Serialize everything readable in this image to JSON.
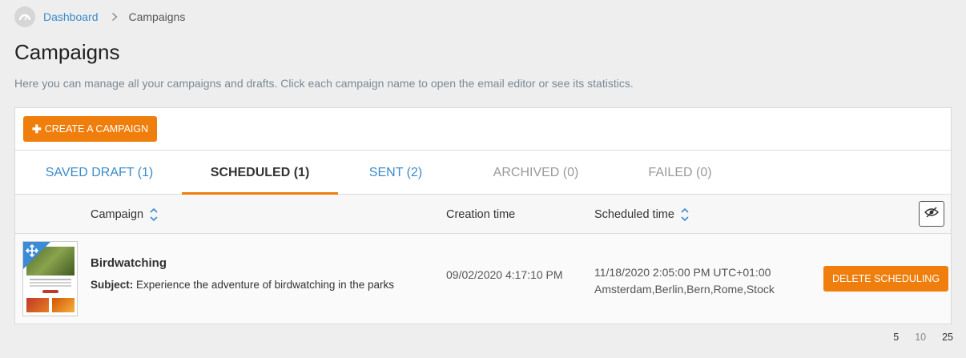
{
  "breadcrumb": {
    "home": "Dashboard",
    "current": "Campaigns"
  },
  "page": {
    "title": "Campaigns",
    "description": "Here you can manage all your campaigns and drafts. Click each campaign name to open the email editor or see its statistics."
  },
  "toolbar": {
    "create_label": "CREATE A CAMPAIGN"
  },
  "tabs": [
    {
      "label": "SAVED DRAFT (1)"
    },
    {
      "label": "SCHEDULED (1)"
    },
    {
      "label": "SENT (2)"
    },
    {
      "label": "ARCHIVED (0)"
    },
    {
      "label": "FAILED (0)"
    }
  ],
  "table": {
    "headers": {
      "campaign": "Campaign",
      "creation": "Creation time",
      "scheduled": "Scheduled time"
    },
    "rows": [
      {
        "name": "Birdwatching",
        "subject_label": "Subject:",
        "subject": "Experience the adventure of birdwatching in the parks",
        "created": "09/02/2020 4:17:10 PM",
        "scheduled_time": "11/18/2020 2:05:00 PM UTC+01:00",
        "scheduled_zones": "Amsterdam,Berlin,Bern,Rome,Stock",
        "action": "DELETE SCHEDULING"
      }
    ]
  },
  "pager": [
    "5",
    "10",
    "25"
  ],
  "colors": {
    "accent": "#f07e0c",
    "link": "#3b8bc9"
  }
}
